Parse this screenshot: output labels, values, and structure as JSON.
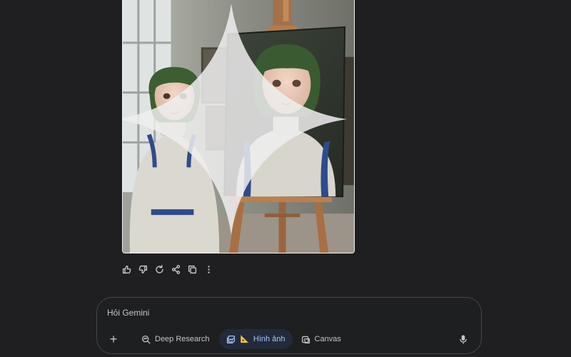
{
  "image": {
    "icon": "gemini-sparkle-icon"
  },
  "actions": [
    {
      "name": "thumbs-up-icon"
    },
    {
      "name": "thumbs-down-icon"
    },
    {
      "name": "refresh-icon"
    },
    {
      "name": "share-icon"
    },
    {
      "name": "copy-icon"
    },
    {
      "name": "more-vert-icon"
    }
  ],
  "prompt": {
    "placeholder": "Hỏi Gemini",
    "plus_label": "+",
    "tools": {
      "deep_research": "Deep Research",
      "images_emoji": "📐",
      "images": "Hình ảnh",
      "canvas": "Canvas"
    },
    "mic_icon": "mic-icon"
  },
  "colors": {
    "background": "#1f1f21",
    "accent": "#a8c7fa",
    "active_chip_bg": "#232a3b",
    "border": "#444746"
  }
}
